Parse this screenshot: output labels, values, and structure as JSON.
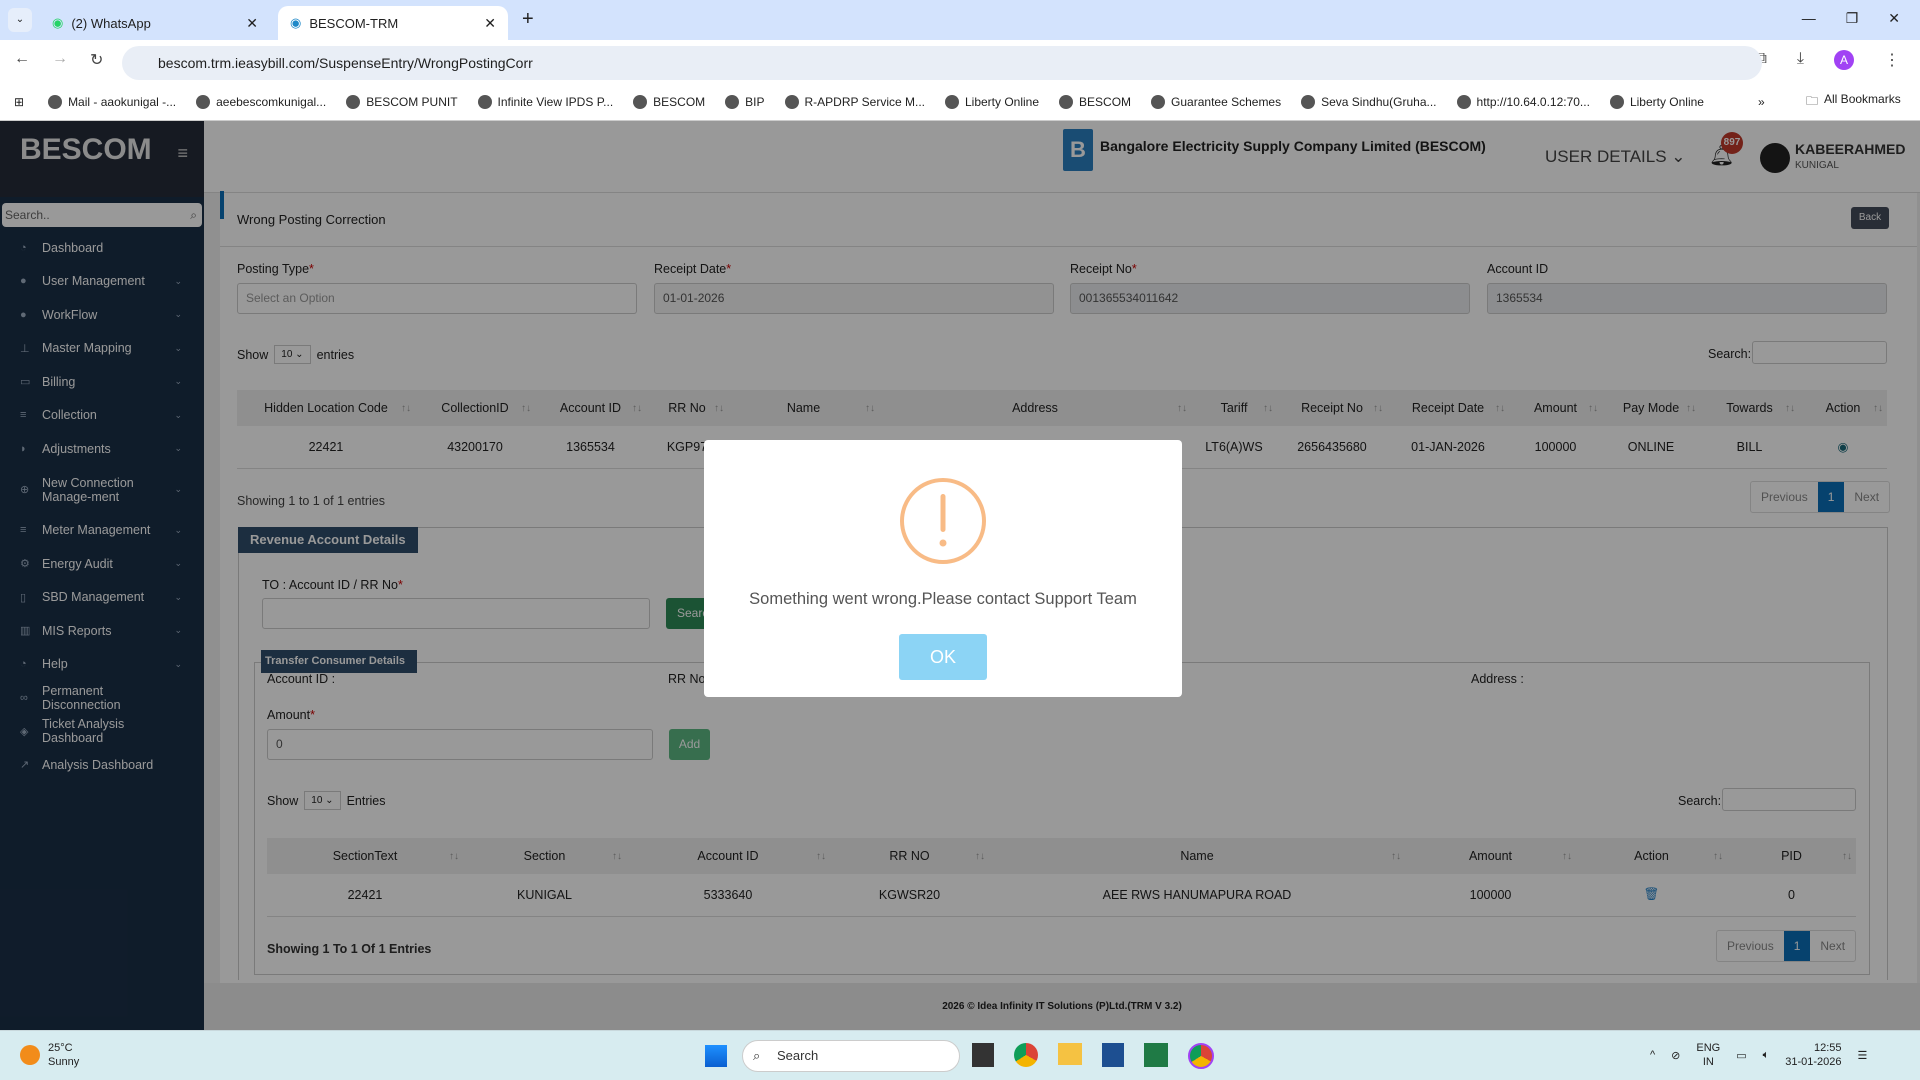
{
  "browser": {
    "tabs": [
      {
        "title": "(2) WhatsApp"
      },
      {
        "title": "BESCOM-TRM"
      }
    ],
    "url": "bescom.trm.ieasybill.com/SuspenseEntry/WrongPostingCorr",
    "bookmarks": [
      "Mail - aaokunigal -...",
      "aeebescomkunigal...",
      "BESCOM PUNIT",
      "Infinite View IPDS P...",
      "BESCOM",
      "BIP",
      "R-APDRP Service M...",
      "Liberty Online",
      "BESCOM",
      "Guarantee Schemes",
      "Seva Sindhu(Gruha...",
      "http://10.64.0.12:70...",
      "Liberty Online"
    ],
    "all_bookmarks": "All Bookmarks"
  },
  "sidebar": {
    "brand": "BESCOM",
    "search_placeholder": "Search..",
    "items": [
      {
        "label": "Dashboard",
        "icon": "dashboard-icon",
        "chev": false
      },
      {
        "label": "User Management",
        "icon": "user-icon",
        "chev": true
      },
      {
        "label": "WorkFlow",
        "icon": "user-icon",
        "chev": true
      },
      {
        "label": "Master Mapping",
        "icon": "sitemap-icon",
        "chev": true
      },
      {
        "label": "Billing",
        "icon": "desktop-icon",
        "chev": true
      },
      {
        "label": "Collection",
        "icon": "list-icon",
        "chev": true
      },
      {
        "label": "Adjustments",
        "icon": "binoculars-icon",
        "chev": true
      },
      {
        "label": "New Connection Manage-ment",
        "icon": "plus-circle-icon",
        "chev": true
      },
      {
        "label": "Meter Management",
        "icon": "list-icon",
        "chev": true
      },
      {
        "label": "Energy Audit",
        "icon": "gears-icon",
        "chev": true
      },
      {
        "label": "SBD Management",
        "icon": "mobile-icon",
        "chev": true
      },
      {
        "label": "MIS Reports",
        "icon": "bar-chart-icon",
        "chev": true
      },
      {
        "label": "Help",
        "icon": "dashboard-icon",
        "chev": true
      },
      {
        "label": "Permanent Disconnection",
        "icon": "link-icon",
        "chev": false
      },
      {
        "label": "Ticket Analysis Dashboard",
        "icon": "ticket-icon",
        "chev": false
      },
      {
        "label": "Analysis Dashboard",
        "icon": "line-chart-icon",
        "chev": false
      }
    ]
  },
  "header": {
    "company": "Bangalore Electricity Supply Company Limited (BESCOM)",
    "user_details": "USER DETAILS",
    "notif_count": "897",
    "user_name": "KABEERAHMED",
    "user_location": "KUNIGAL"
  },
  "page": {
    "title": "Wrong Posting Correction",
    "back": "Back",
    "fields": {
      "posting_type": {
        "label": "Posting Type",
        "placeholder": "Select an Option"
      },
      "receipt_date": {
        "label": "Receipt Date",
        "value": "01-01-2026"
      },
      "receipt_no": {
        "label": "Receipt No",
        "value": "001365534011642"
      },
      "account_id": {
        "label": "Account ID",
        "value": "1365534"
      }
    },
    "show": "Show",
    "entries": "entries",
    "page_size": "10",
    "search_label": "Search:",
    "table1": {
      "headers": [
        "Hidden Location Code",
        "CollectionID",
        "Account ID",
        "RR No",
        "Name",
        "Address",
        "Tariff",
        "Receipt No",
        "Receipt Date",
        "Amount",
        "Pay Mode",
        "Towards",
        "Action"
      ],
      "rows": [
        [
          "22421",
          "43200170",
          "1365534",
          "KGP97",
          "",
          "",
          "LT6(A)WS",
          "2656435680",
          "01-JAN-2026",
          "100000",
          "ONLINE",
          "BILL",
          ""
        ]
      ]
    },
    "showing1": "Showing 1 to 1 of 1 entries",
    "pagination": {
      "previous": "Previous",
      "current": "1",
      "next": "Next"
    },
    "revenue": {
      "title": "Revenue Account Details",
      "to_label": "TO : Account ID / RR No",
      "search_btn": "Search"
    },
    "transfer": {
      "title": "Transfer Consumer Details",
      "account_id": "Account ID :",
      "rr_no": "RR No",
      "address": "Address :",
      "amount_label": "Amount",
      "amount_value": "0",
      "add_btn": "Add",
      "show": "Show",
      "entries": "Entries",
      "page_size": "10",
      "search_label": "Search:"
    },
    "table2": {
      "headers": [
        "SectionText",
        "Section",
        "Account ID",
        "RR NO",
        "Name",
        "Amount",
        "Action",
        "PID"
      ],
      "rows": [
        [
          "22421",
          "KUNIGAL",
          "5333640",
          "KGWSR20",
          "AEE RWS HANUMAPURA ROAD",
          "100000",
          "",
          "0"
        ]
      ]
    },
    "showing2": "Showing 1 To 1 Of 1 Entries",
    "footer": "2026 © Idea Infinity IT Solutions (P)Ltd.(TRM V 3.2)"
  },
  "modal": {
    "message": "Something went wrong.Please contact Support Team",
    "ok": "OK",
    "warning_color": "#f8bb86",
    "ok_color": "#8cd4f5"
  },
  "taskbar": {
    "temp": "25°C",
    "weather": "Sunny",
    "search": "Search",
    "lang1": "ENG",
    "lang2": "IN",
    "time": "12:55",
    "date": "31-01-2026"
  }
}
